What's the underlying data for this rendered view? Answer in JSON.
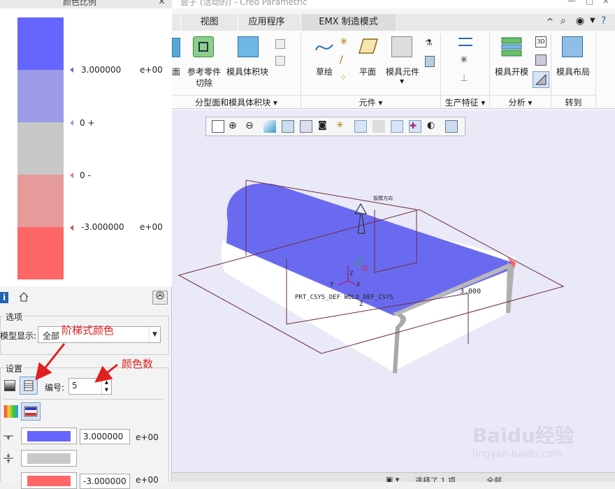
{
  "left_panel": {
    "title": "颜色比例",
    "close": "×",
    "scale": {
      "bands": [
        "#6666ff",
        "#9b9be6",
        "#c8c8c8",
        "#e69b9b",
        "#ff6666"
      ],
      "labels": [
        {
          "value": "3.000000",
          "exp": "e+00",
          "mark_color": "#7070c0"
        },
        {
          "value": "0 +",
          "exp": "",
          "mark_color": "#9a9ad0"
        },
        {
          "value": "0 -",
          "exp": "",
          "mark_color": "#d08080"
        },
        {
          "value": "-3.000000",
          "exp": "e+00",
          "mark_color": "#d05050"
        }
      ]
    },
    "options_group": {
      "title": "选项",
      "model_display_label": "模型显示:",
      "model_display_value": "全部"
    },
    "settings_group": {
      "title": "设置",
      "count_label": "编号:",
      "count_value": "5",
      "rows": [
        {
          "color": "#6666ff",
          "value": "3.000000",
          "exp": "e+00"
        },
        {
          "color": "#c8c8c8",
          "value": "",
          "exp": ""
        },
        {
          "color": "#ff6666",
          "value": "-3.000000",
          "exp": "e+00"
        }
      ]
    }
  },
  "annotations": {
    "step_color": "阶梯式颜色",
    "color_count": "颜色数",
    "color": "#e02020"
  },
  "ribbon": {
    "window_title": "壹子 (活动的) - Creo Parametric",
    "tabs": [
      "视图",
      "应用程序",
      "EMX 制造模式"
    ],
    "buttons": {
      "face": "面",
      "ref_part_cut_1": "参考零件",
      "ref_part_cut_2": "切除",
      "mold_volume": "模具体积块",
      "sketch": "草绘",
      "plane": "平面",
      "mold_component": "模具元件",
      "mold_open": "模具开模",
      "mold_layout": "模具布局"
    },
    "groups": {
      "parting_volume": "分型面和模具体积块 ▾",
      "component": "元件 ▾",
      "production_feature": "生产特征 ▾",
      "analysis": "分析 ▾",
      "goto": "转到"
    }
  },
  "viewport": {
    "labels": {
      "draft_top": "拔模方向",
      "csys": "PRT_CSYS_DEF WOLD_DEF_CSYS",
      "axis_y": "Y",
      "axis_x": "X",
      "axis_z": "Z",
      "axis_z2": "Z",
      "value": "3.000"
    },
    "colors": {
      "part_blue": "#6a6af0",
      "part_red": "#ff6060",
      "background": "#e9e9f8",
      "outline": "#6e2c3a"
    }
  },
  "statusbar": {
    "selected": "选择了 1 项",
    "filter": "全部"
  },
  "watermark": {
    "brand": "Baidu经验",
    "url": "jingyan.baidu.com"
  }
}
